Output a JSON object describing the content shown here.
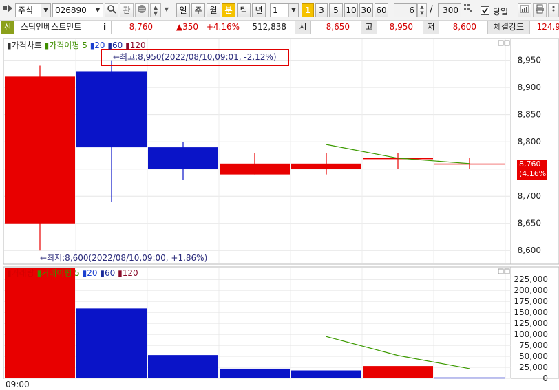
{
  "toolbar": {
    "market_type": "주식",
    "stock_code": "026890",
    "search_icon": "search-icon",
    "watch_label": "관",
    "period_buttons": [
      "일",
      "주",
      "월",
      "분",
      "틱",
      "년"
    ],
    "active_period": "분",
    "interval_value": "1",
    "interval_quick": [
      "1",
      "3",
      "5",
      "10",
      "30",
      "60"
    ],
    "active_interval": "1",
    "zoom_value": "6",
    "divider": "/",
    "count_value": "300",
    "today_label": "당일",
    "today_checked": true
  },
  "info": {
    "badge": "신",
    "stock_name": "스틱인베스트먼트",
    "info_icon_label": "i",
    "price": "8,760",
    "change": "▲350",
    "change_pct": "+4.16%",
    "volume": "512,838",
    "open_label": "시",
    "open": "8,650",
    "high_label": "고",
    "high": "8,950",
    "low_label": "저",
    "low": "8,600",
    "strength_label": "체결강도",
    "strength": "124.9"
  },
  "price_pane": {
    "title": "가격차트",
    "ma_label": "가격이평",
    "ma_periods": [
      "5",
      "20",
      "60",
      "120"
    ],
    "high_annotation": "←최고:8,950(2022/08/10,09:01, -2.12%)",
    "low_annotation": "←최저:8,600(2022/08/10,09:00, +1.86%)",
    "axis_ticks": [
      "8,950",
      "8,900",
      "8,850",
      "8,800",
      "8,700",
      "8,650",
      "8,600"
    ],
    "current_price_label": "8,760",
    "current_pct_label": "(4.16%)"
  },
  "volume_pane": {
    "title": "거래량",
    "ma_label": "거래이평",
    "ma_periods": [
      "5",
      "20",
      "60",
      "120"
    ],
    "axis_ticks": [
      "225,000",
      "200,000",
      "175,000",
      "150,000",
      "125,000",
      "100,000",
      "75,000",
      "50,000",
      "25,000",
      "0"
    ]
  },
  "time_axis": {
    "first_label": "09:00"
  },
  "colors": {
    "up": "#e80000",
    "down": "#0a14c8",
    "ma5": "#3c9a00",
    "highlight_box": "#e00000"
  },
  "chart_data": [
    {
      "type": "candlestick",
      "title": "가격차트",
      "ylim": [
        8575,
        8985
      ],
      "candles": [
        {
          "open": 8650,
          "high": 8940,
          "low": 8600,
          "close": 8920
        },
        {
          "open": 8930,
          "high": 8950,
          "low": 8690,
          "close": 8790
        },
        {
          "open": 8790,
          "high": 8800,
          "low": 8730,
          "close": 8750
        },
        {
          "open": 8740,
          "high": 8780,
          "low": 8740,
          "close": 8760
        },
        {
          "open": 8750,
          "high": 8780,
          "low": 8740,
          "close": 8760
        },
        {
          "open": 8770,
          "high": 8780,
          "low": 8750,
          "close": 8770
        },
        {
          "open": 8760,
          "high": 8770,
          "low": 8750,
          "close": 8760
        }
      ],
      "ma5": [
        null,
        null,
        null,
        null,
        8795,
        8770,
        8760
      ],
      "last_price": 8760
    },
    {
      "type": "bar",
      "title": "거래량",
      "ylim": [
        0,
        230000
      ],
      "values": [
        255000,
        159000,
        53000,
        22000,
        18000,
        28000,
        2000
      ],
      "bar_colors": [
        "up",
        "down",
        "down",
        "down",
        "down",
        "up",
        "down"
      ],
      "ma5": [
        null,
        null,
        null,
        null,
        95000,
        52000,
        22000
      ]
    }
  ]
}
